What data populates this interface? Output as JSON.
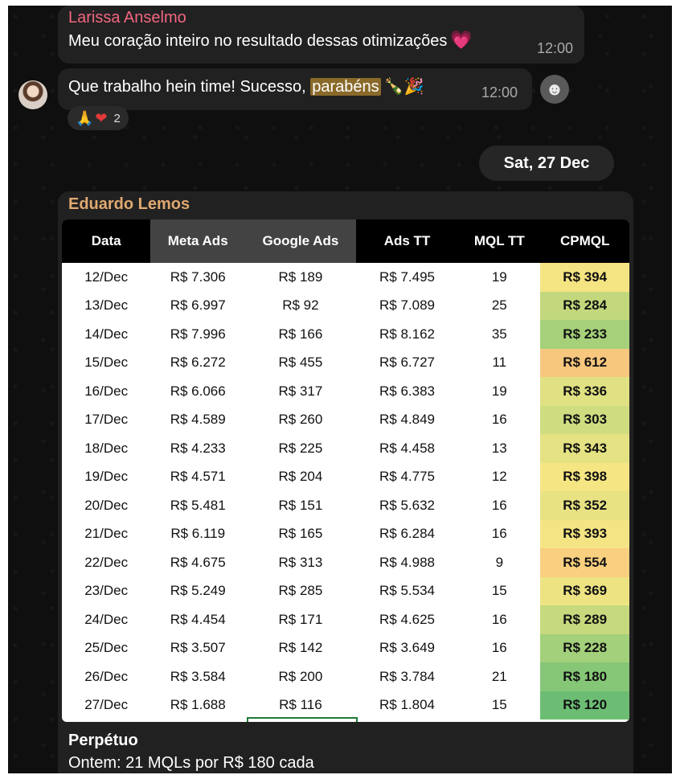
{
  "messages": [
    {
      "sender": "Larissa Anselmo",
      "text": "Meu coração inteiro no resultado dessas otimizações",
      "emoji": "💗",
      "time": "12:00"
    },
    {
      "text_before": "Que trabalho hein time! Sucesso, ",
      "highlight": "parabéns",
      "emoji": "🍾🎉",
      "time": "12:00"
    }
  ],
  "reactions": {
    "emoji1": "🙏",
    "emoji2": "❤",
    "count": "2"
  },
  "react_button_icon": "☻",
  "date_separator": "Sat, 27 Dec",
  "table_message": {
    "sender": "Eduardo Lemos",
    "headers": [
      "Data",
      "Meta Ads",
      "Google Ads",
      "Ads TT",
      "MQL TT",
      "CPMQL"
    ],
    "rows": [
      {
        "data": "12/Dec",
        "meta": "R$ 7.306",
        "google": "R$ 189",
        "ads": "R$ 7.495",
        "mql": "19",
        "cpmql": "R$ 394",
        "color": "#f5e482"
      },
      {
        "data": "13/Dec",
        "meta": "R$ 6.997",
        "google": "R$ 92",
        "ads": "R$ 7.089",
        "mql": "25",
        "cpmql": "R$ 284",
        "color": "#c3d87c"
      },
      {
        "data": "14/Dec",
        "meta": "R$ 7.996",
        "google": "R$ 166",
        "ads": "R$ 8.162",
        "mql": "35",
        "cpmql": "R$ 233",
        "color": "#a6d17a"
      },
      {
        "data": "15/Dec",
        "meta": "R$ 6.272",
        "google": "R$ 455",
        "ads": "R$ 6.727",
        "mql": "11",
        "cpmql": "R$ 612",
        "color": "#f8c77e"
      },
      {
        "data": "16/Dec",
        "meta": "R$ 6.066",
        "google": "R$ 317",
        "ads": "R$ 6.383",
        "mql": "19",
        "cpmql": "R$ 336",
        "color": "#e0e182"
      },
      {
        "data": "17/Dec",
        "meta": "R$ 4.589",
        "google": "R$ 260",
        "ads": "R$ 4.849",
        "mql": "16",
        "cpmql": "R$ 303",
        "color": "#cfdd80"
      },
      {
        "data": "18/Dec",
        "meta": "R$ 4.233",
        "google": "R$ 225",
        "ads": "R$ 4.458",
        "mql": "13",
        "cpmql": "R$ 343",
        "color": "#e4e282"
      },
      {
        "data": "19/Dec",
        "meta": "R$ 4.571",
        "google": "R$ 204",
        "ads": "R$ 4.775",
        "mql": "12",
        "cpmql": "R$ 398",
        "color": "#f6e583"
      },
      {
        "data": "20/Dec",
        "meta": "R$ 5.481",
        "google": "R$ 151",
        "ads": "R$ 5.632",
        "mql": "16",
        "cpmql": "R$ 352",
        "color": "#e8e283"
      },
      {
        "data": "21/Dec",
        "meta": "R$ 6.119",
        "google": "R$ 165",
        "ads": "R$ 6.284",
        "mql": "16",
        "cpmql": "R$ 393",
        "color": "#f5e483"
      },
      {
        "data": "22/Dec",
        "meta": "R$ 4.675",
        "google": "R$ 313",
        "ads": "R$ 4.988",
        "mql": "9",
        "cpmql": "R$ 554",
        "color": "#f9d07f"
      },
      {
        "data": "23/Dec",
        "meta": "R$ 5.249",
        "google": "R$ 285",
        "ads": "R$ 5.534",
        "mql": "15",
        "cpmql": "R$ 369",
        "color": "#eee383"
      },
      {
        "data": "24/Dec",
        "meta": "R$ 4.454",
        "google": "R$ 171",
        "ads": "R$ 4.625",
        "mql": "16",
        "cpmql": "R$ 289",
        "color": "#c6d97d"
      },
      {
        "data": "25/Dec",
        "meta": "R$ 3.507",
        "google": "R$ 142",
        "ads": "R$ 3.649",
        "mql": "16",
        "cpmql": "R$ 228",
        "color": "#a3d07a"
      },
      {
        "data": "26/Dec",
        "meta": "R$ 3.584",
        "google": "R$ 200",
        "ads": "R$ 3.784",
        "mql": "21",
        "cpmql": "R$ 180",
        "color": "#86c677"
      },
      {
        "data": "27/Dec",
        "meta": "R$ 1.688",
        "google": "R$ 116",
        "ads": "R$ 1.804",
        "mql": "15",
        "cpmql": "R$ 120",
        "color": "#6cbd73"
      }
    ],
    "caption_title": "Perpétuo",
    "caption_body": "Ontem: 21 MQLs por R$ 180 cada"
  }
}
